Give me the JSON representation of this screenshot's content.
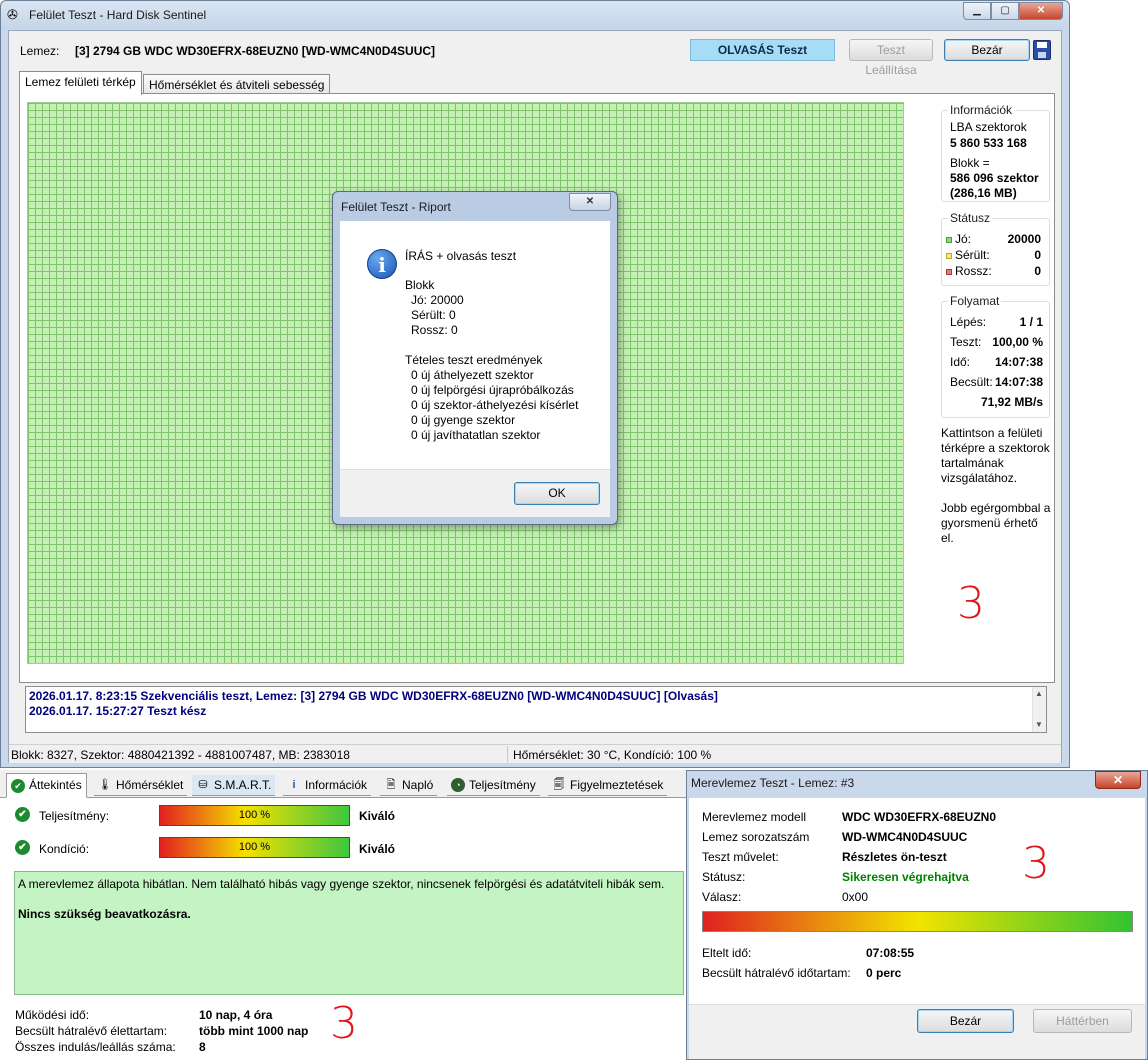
{
  "main_window": {
    "title": "Felület Teszt - Hard Disk Sentinel",
    "disk_label": "Lemez:",
    "disk_value": "[3] 2794 GB  WDC WD30EFRX-68EUZN0 [WD-WMC4N0D4SUUC]",
    "test_status": "OLVASÁS Teszt",
    "stop_button": "Teszt Leállítása",
    "close_button": "Bezár",
    "tabs": [
      "Lemez felületi térkép",
      "Hőmérséklet és átviteli sebesség"
    ],
    "info": {
      "title": "Információk",
      "lba_label": "LBA szektorok",
      "lba_value": "5 860 533 168",
      "block_label": "Blokk =",
      "block_value": "586 096 szektor",
      "block_size": "(286,16 MB)"
    },
    "status": {
      "title": "Státusz",
      "good_label": "Jó:",
      "good_value": "20000",
      "damaged_label": "Sérült:",
      "damaged_value": "0",
      "bad_label": "Rossz:",
      "bad_value": "0"
    },
    "progress": {
      "title": "Folyamat",
      "step_label": "Lépés:",
      "step_value": "1 / 1",
      "test_label": "Teszt:",
      "test_value": "100,00 %",
      "time_label": "Idő:",
      "time_value": "14:07:38",
      "est_label": "Becsült:",
      "est_value": "14:07:38",
      "speed": "71,92 MB/s"
    },
    "hint1": "Kattintson a felületi térképre a szektorok tartalmának vizsgálatához.",
    "hint2": "Jobb egérgombbal a gyorsmenü érhető el.",
    "log": [
      "2026.01.17.  8:23:15   Szekvenciális teszt, Lemez: [3] 2794 GB  WDC WD30EFRX-68EUZN0 [WD-WMC4N0D4SUUC] [Olvasás]",
      "2026.01.17.  15:27:27   Teszt kész"
    ],
    "statusbar_left": "Blokk: 8327, Szektor: 4880421392 - 4881007487, MB: 2383018",
    "statusbar_right": "Hőmérséklet: 30  °C,  Kondíció: 100 %"
  },
  "report_dialog": {
    "title": "Felület Teszt - Riport",
    "heading": "ÍRÁS + olvasás teszt",
    "block_title": "Blokk",
    "good": "Jó: 20000",
    "damaged": "Sérült: 0",
    "bad": "Rossz: 0",
    "results_title": "Tételes teszt eredmények",
    "results": [
      "0 új áthelyezett szektor",
      "0 új felpörgési újrapróbálkozás",
      "0 új szektor-áthelyezési kísérlet",
      "0 új gyenge szektor",
      "0 új javíthatatlan szektor"
    ],
    "ok_button": "OK"
  },
  "bottom_panel": {
    "tabs": [
      "Áttekintés",
      "Hőmérséklet",
      "S.M.A.R.T.",
      "Információk",
      "Napló",
      "Teljesítmény",
      "Figyelmeztetések"
    ],
    "performance_label": "Teljesítmény:",
    "performance_percent": 100,
    "performance_text": "100 %",
    "performance_rating": "Kiváló",
    "health_label": "Kondíció:",
    "health_percent": 100,
    "health_text": "100 %",
    "health_rating": "Kiváló",
    "message": "A merevlemez állapota hibátlan. Nem található hibás vagy gyenge szektor, nincsenek felpörgési és adatátviteli hibák sem.",
    "message_bold": "Nincs szükség beavatkozásra.",
    "uptime_label": "Működési idő:",
    "uptime_value": "10 nap, 4 óra",
    "lifetime_label": "Becsült hátralévő élettartam:",
    "lifetime_value": "több mint 1000 nap",
    "startstop_label": "Összes indulás/leállás száma:",
    "startstop_value": "8"
  },
  "hd_test_dialog": {
    "title": "Merevlemez Teszt - Lemez: #3",
    "model_label": "Merevlemez modell",
    "model_value": "WDC WD30EFRX-68EUZN0",
    "serial_label": "Lemez sorozatszám",
    "serial_value": "WD-WMC4N0D4SUUC",
    "op_label": "Teszt művelet:",
    "op_value": "Részletes ön-teszt",
    "status_label": "Státusz:",
    "status_value": "Sikeresen végrehajtva",
    "response_label": "Válasz:",
    "response_value": "0x00",
    "progress_percent": 100,
    "elapsed_label": "Eltelt idő:",
    "elapsed_value": "07:08:55",
    "remaining_label": "Becsült hátralévő időtartam:",
    "remaining_value": "0 perc",
    "close_button": "Bezár",
    "background_button": "Háttérben"
  },
  "annotations": [
    "3",
    "3",
    "3"
  ],
  "colors": {
    "good": "#3ec73e",
    "status_ok": "#008000",
    "log_text": "#000080",
    "test_badge": "#a6dcf5"
  }
}
